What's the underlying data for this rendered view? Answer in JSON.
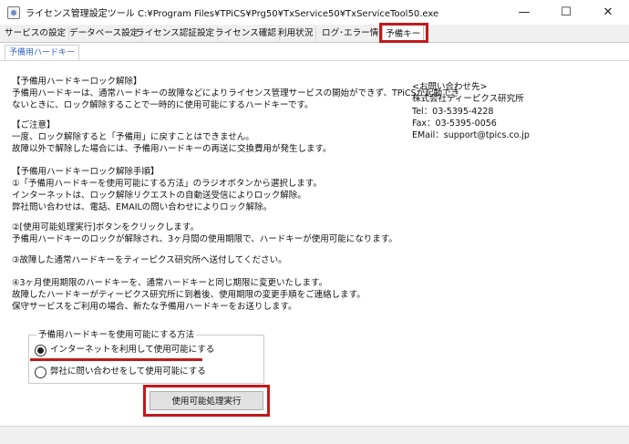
{
  "window": {
    "title": "ライセンス管理設定ツール  C:¥Program Files¥TPiCS¥Prg50¥TxService50¥TxServiceTool50.exe",
    "controls": {
      "minimize": "—",
      "maximize": "☐",
      "close": "✕"
    }
  },
  "tabs": [
    {
      "label": "サービスの設定"
    },
    {
      "label": "データベース設定"
    },
    {
      "label": "ライセンス認証設定"
    },
    {
      "label": "ライセンス確認"
    },
    {
      "label": "利用状況"
    },
    {
      "label": "ログ･エラー情報"
    },
    {
      "label": "予備キー",
      "active": true
    }
  ],
  "subtab": {
    "label": "予備用ハードキー"
  },
  "content": {
    "left_lines": [
      "【予備用ハードキーロック解除】",
      "予備用ハードキーは、通常ハードキーの故障などによりライセンス管理サービスの開始ができず、TPiCSが起動でき",
      "ないときに、ロック解除することで一時的に使用可能にするハードキーです。",
      "",
      "【ご注意】",
      "一度、ロック解除すると「予備用」に戻すことはできません。",
      "故障以外で解除した場合には、予備用ハードキーの再送に交換費用が発生します。",
      "",
      "【予備用ハードキーロック解除手順】",
      "①「予備用ハードキーを使用可能にする方法」のラジオボタンから選択します。",
      "  インターネットは、ロック解除リクエストの自動送受信によりロック解除。",
      "  弊社問い合わせは、電話、EMAILの問い合わせによりロック解除。",
      "",
      "②[使用可能処理実行]ボタンをクリックします。",
      "  予備用ハードキーのロックが解除され、3ヶ月間の使用期限で、ハードキーが使用可能になります。",
      "",
      "③故障した通常ハードキーをティーピクス研究所へ送付してください。",
      "",
      "④3ヶ月使用期限のハードキーを、通常ハードキーと同じ期限に変更いたします。",
      "  故障したハードキーがティーピクス研究所に到着後、使用期限の変更手順をご連絡します。",
      "  保守サービスをご利用の場合、新たな予備用ハードキーをお送りします。"
    ],
    "contact_lines": [
      "<お問い合わせ先>",
      "株式会社ティーピクス研究所",
      "Tel：03-5395-4228",
      "Fax：03-5395-0056",
      "EMail：support@tpics.co.jp"
    ]
  },
  "method_group": {
    "legend": "予備用ハードキーを使用可能にする方法",
    "options": [
      {
        "label": "インターネットを利用して使用可能にする",
        "selected": true
      },
      {
        "label": "弊社に問い合わせをして使用可能にする",
        "selected": false
      }
    ]
  },
  "exec_button": {
    "label": "使用可能処理実行"
  },
  "highlight_color": "#c11a1a"
}
